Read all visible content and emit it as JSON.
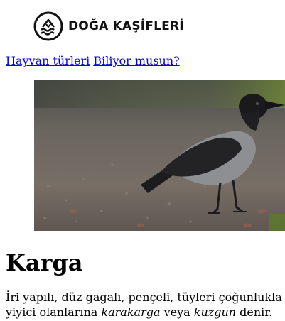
{
  "brand": {
    "name": "DOĞA KAŞİFLERİ",
    "logo_icon": "mountain-waves-logo-icon"
  },
  "nav": {
    "links": [
      {
        "label": "Hayvan türleri"
      },
      {
        "label": "Biliyor musun?"
      }
    ],
    "link_color": "#0000ee"
  },
  "hero": {
    "icon": "crow-photo"
  },
  "article": {
    "title": "Karga",
    "intro_line1": "İri yapılı, düz gagalı, pençeli, tüyleri çoğunlukla s",
    "intro_line2_a": "yiyici olanlarına ",
    "intro_line2_em1": "karakarga",
    "intro_line2_b": " veya ",
    "intro_line2_em2": "kuzgun",
    "intro_line2_c": " denir."
  }
}
